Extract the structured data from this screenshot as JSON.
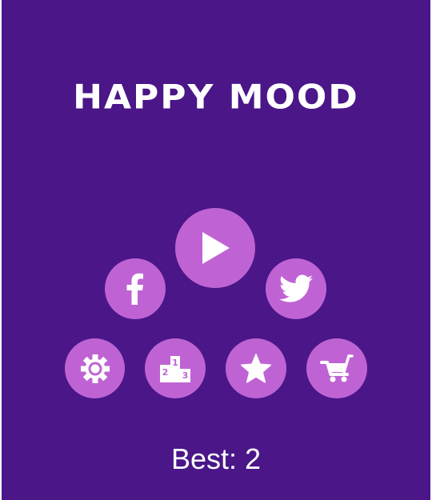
{
  "title": "HAPPY MOOD",
  "best": {
    "text": "Best: 2"
  },
  "colors": {
    "background": "#4a1688",
    "button": "#bf63d4",
    "text": "#ffffff"
  },
  "buttons": [
    {
      "id": "play",
      "icon": "play-icon"
    },
    {
      "id": "facebook",
      "icon": "facebook-icon"
    },
    {
      "id": "twitter",
      "icon": "twitter-icon"
    },
    {
      "id": "settings",
      "icon": "gear-icon"
    },
    {
      "id": "leaderboard",
      "icon": "podium-icon",
      "podium_labels": [
        "2",
        "1",
        "3"
      ]
    },
    {
      "id": "rate",
      "icon": "star-icon"
    },
    {
      "id": "shop",
      "icon": "cart-icon"
    }
  ]
}
